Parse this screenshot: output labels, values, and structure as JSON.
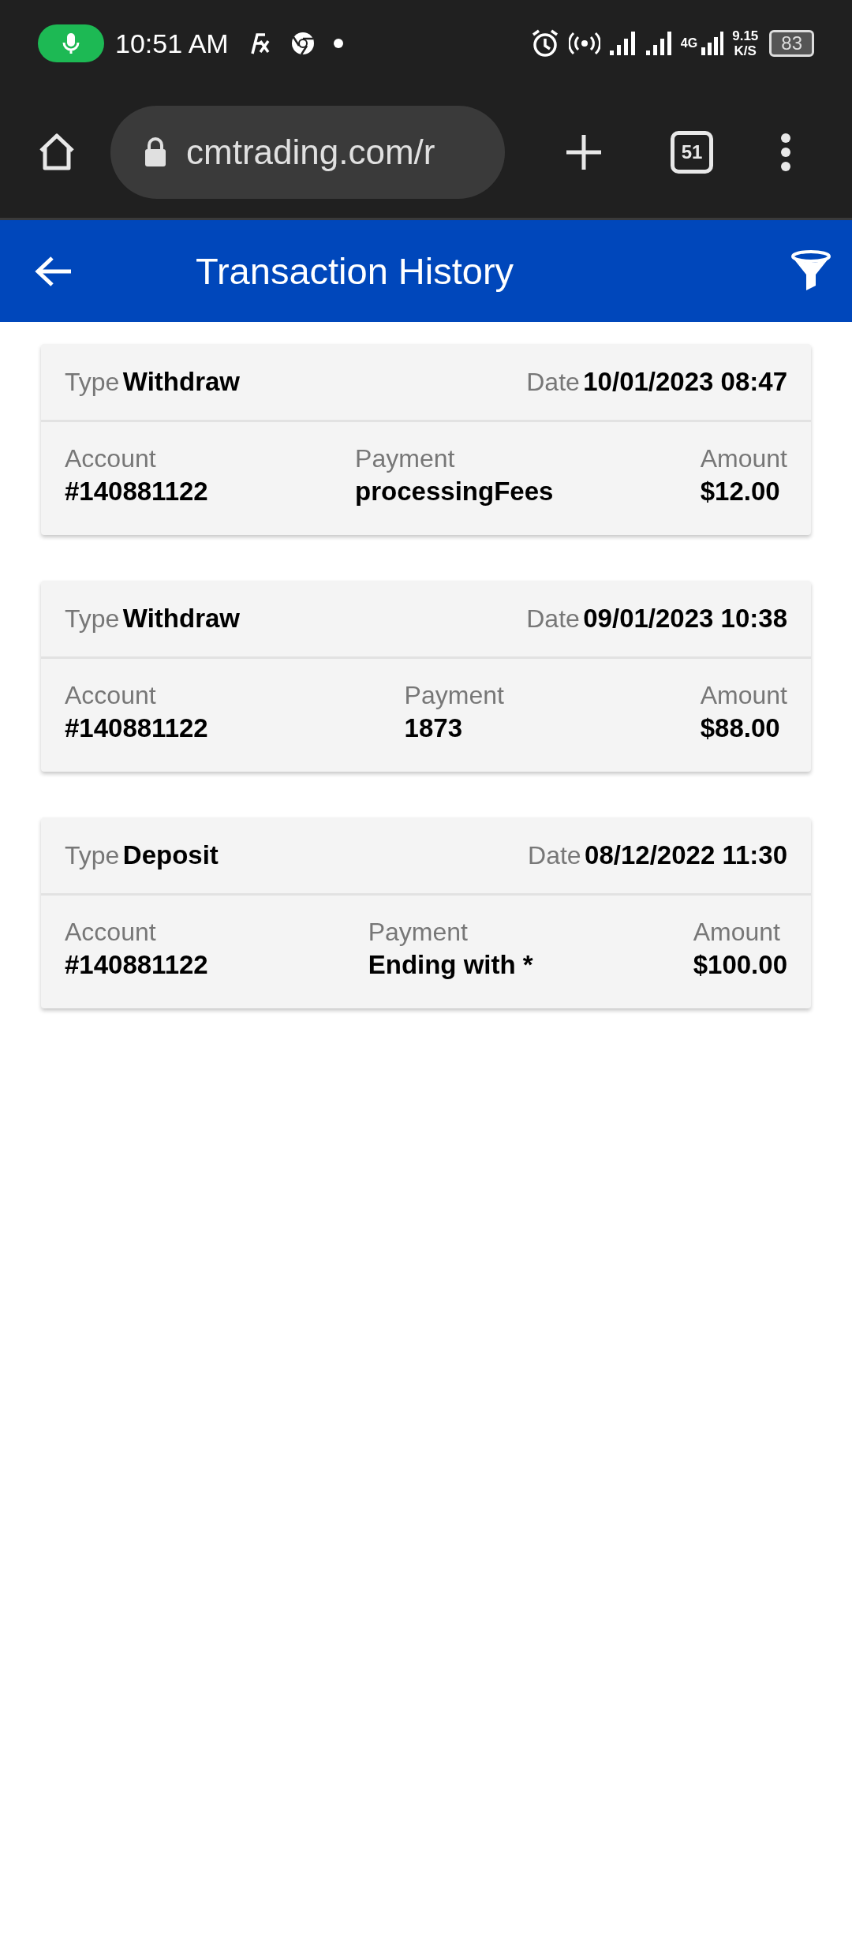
{
  "status_bar": {
    "time": "10:51 AM",
    "network": "4G",
    "speed_value": "9.15",
    "speed_unit": "K/S",
    "battery": "83",
    "mic_active": true
  },
  "browser": {
    "url": "cmtrading.com/r",
    "tab_count": "51"
  },
  "header": {
    "title": "Transaction History"
  },
  "transactions": [
    {
      "type_label": "Type",
      "type": "Withdraw",
      "date_label": "Date",
      "date": "10/01/2023 08:47",
      "account_label": "Account",
      "account": "#140881122",
      "payment_label": "Payment",
      "payment": "processingFees",
      "amount_label": "Amount",
      "amount": "$12.00"
    },
    {
      "type_label": "Type",
      "type": "Withdraw",
      "date_label": "Date",
      "date": "09/01/2023 10:38",
      "account_label": "Account",
      "account": "#140881122",
      "payment_label": "Payment",
      "payment": "1873",
      "amount_label": "Amount",
      "amount": "$88.00"
    },
    {
      "type_label": "Type",
      "type": "Deposit",
      "date_label": "Date",
      "date": "08/12/2022 11:30",
      "account_label": "Account",
      "account": "#140881122",
      "payment_label": "Payment",
      "payment": "Ending with *",
      "amount_label": "Amount",
      "amount": "$100.00"
    }
  ]
}
